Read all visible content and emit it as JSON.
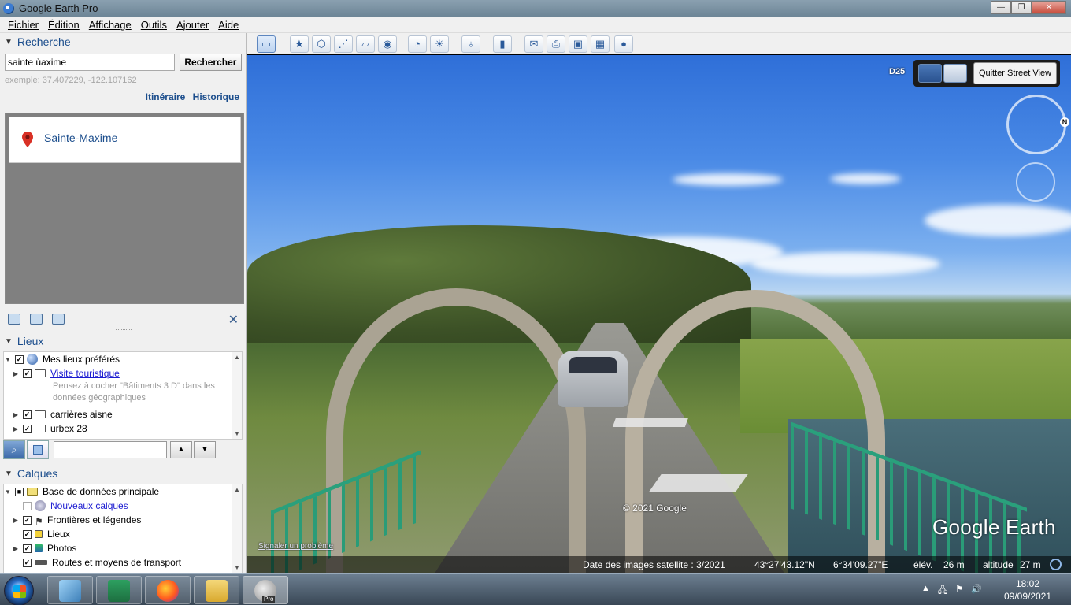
{
  "window": {
    "title": "Google Earth Pro",
    "min": "—",
    "max": "❐",
    "close": "✕"
  },
  "menu": [
    "Fichier",
    "Édition",
    "Affichage",
    "Outils",
    "Ajouter",
    "Aide"
  ],
  "search": {
    "header": "Recherche",
    "value": "sainte ùaxime",
    "button": "Rechercher",
    "example": "exemple: 37.407229, -122.107162",
    "link_itinerary": "Itinéraire",
    "link_history": "Historique",
    "result": "Sainte-Maxime"
  },
  "places": {
    "header": "Lieux",
    "items": [
      {
        "label": "Mes lieux préférés",
        "checked": true
      },
      {
        "label": "Visite touristique",
        "checked": true,
        "link": true
      },
      {
        "label": "Pensez à cocher \"Bâtiments 3 D\" dans les données géographiques"
      },
      {
        "label": "carrières aisne",
        "checked": true
      },
      {
        "label": "urbex 28",
        "checked": true
      }
    ]
  },
  "layers": {
    "header": "Calques",
    "items": [
      {
        "label": "Base de données principale"
      },
      {
        "label": "Nouveaux calques",
        "link": true
      },
      {
        "label": "Frontières et légendes",
        "checked": true
      },
      {
        "label": "Lieux",
        "checked": true
      },
      {
        "label": "Photos",
        "checked": true
      },
      {
        "label": "Routes et moyens de transport",
        "checked": true
      }
    ]
  },
  "streetview": {
    "road_label": "D25",
    "quit_button": "Quitter Street View",
    "compass_n": "N",
    "copyright": "© 2021 Google",
    "report": "Signaler un problème",
    "logo": "Google Earth"
  },
  "status": {
    "imagery_date": "Date des images satellite : 3/2021",
    "lat": "43°27'43.12\"N",
    "lon": "6°34'09.27\"E",
    "elev_label": "élév.",
    "elev_value": "26 m",
    "alt_label": "altitude",
    "alt_value": "27 m"
  },
  "taskbar": {
    "time": "18:02",
    "date": "09/09/2021",
    "ge_label": "Pro"
  }
}
